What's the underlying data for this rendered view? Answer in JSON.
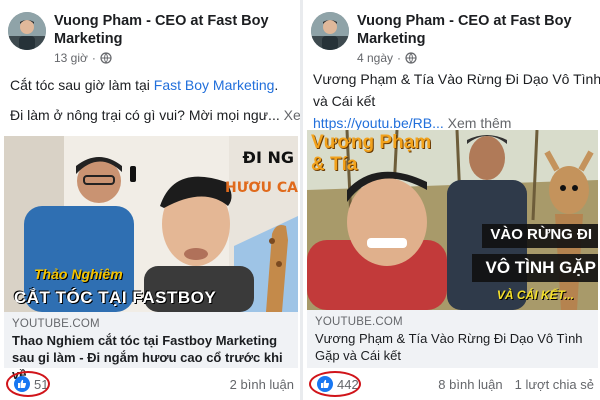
{
  "left_post": {
    "author": "Vuong Pham - CEO at Fast Boy Marketing",
    "time": "13 giờ",
    "text_line1_prefix": "Cắt tóc sau giờ làm tại ",
    "text_line1_link": "Fast Boy Marketing",
    "text_line1_suffix": ".",
    "text_line2": "Đi làm ở nông trại có gì vui? Mời mọi ngư...",
    "see_more": "Xem t",
    "image": {
      "overlay_top_right": "ĐI NG",
      "overlay_mid_right": "HƯƠU CA",
      "caption_name": "Thảo Nghiêm",
      "caption_main": "CẮT TÓC TẠI FASTBOY"
    },
    "link_domain": "YOUTUBE.COM",
    "link_title": "Thao Nghiem cắt tóc tại Fastboy Marketing sau gi làm - Đi ngắm hươu cao cổ trước khi về",
    "likes": "51",
    "comments": "2 bình luận"
  },
  "right_post": {
    "author": "Vuong Pham - CEO at Fast Boy Marketing",
    "time": "4 ngày",
    "text_line1": "Vương Phạm & Tía Vào Rừng Đi Dạo Vô Tình Gặp",
    "text_line2": "và Cái kết",
    "link_url": "https://youtu.be/RB...",
    "see_more": "Xem thêm",
    "image": {
      "title_line1": "Vương Phạm",
      "title_line2": "& Tía",
      "banner1": "VÀO RỪNG ĐI",
      "banner2": "VÔ TÌNH GẶP",
      "banner3": "VÀ CÁI KẾT..."
    },
    "link_domain": "YOUTUBE.COM",
    "link_title": "Vương Phạm & Tía Vào Rừng Đi Dạo Vô Tình Gặp và Cái kết",
    "likes": "442",
    "comments": "8 bình luận",
    "shares": "1 lượt chia sẻ"
  },
  "colors": {
    "facebook_blue": "#1877f2",
    "link_blue": "#216fdb",
    "highlight_red": "#d0141a"
  }
}
